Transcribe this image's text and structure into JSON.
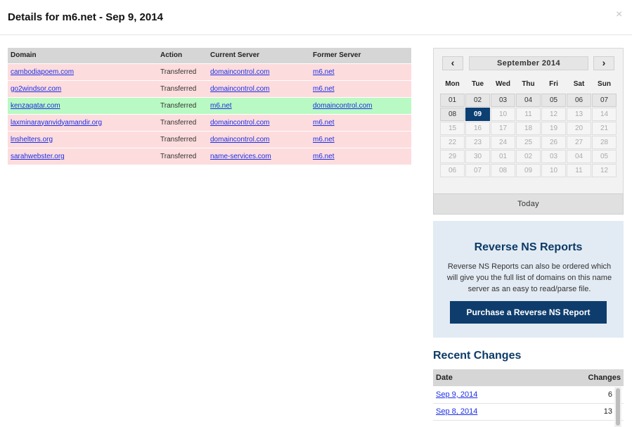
{
  "dialog": {
    "title": "Details for m6.net - Sep 9, 2014",
    "close_icon": "×"
  },
  "domains_table": {
    "headers": [
      "Domain",
      "Action",
      "Current Server",
      "Former Server"
    ],
    "rows": [
      {
        "domain": "cambodiapoem.com",
        "action": "Transferred",
        "current": "domaincontrol.com",
        "former": "m6.net",
        "status_color": "#fddcdd"
      },
      {
        "domain": "go2windsor.com",
        "action": "Transferred",
        "current": "domaincontrol.com",
        "former": "m6.net",
        "status_color": "#fddcdd"
      },
      {
        "domain": "kenzaqatar.com",
        "action": "Transferred",
        "current": "m6.net",
        "former": "domaincontrol.com",
        "status_color": "#b9f9c3"
      },
      {
        "domain": "laxminarayanvidyamandir.org",
        "action": "Transferred",
        "current": "domaincontrol.com",
        "former": "m6.net",
        "status_color": "#fddcdd"
      },
      {
        "domain": "lnshelters.org",
        "action": "Transferred",
        "current": "domaincontrol.com",
        "former": "m6.net",
        "status_color": "#fddcdd"
      },
      {
        "domain": "sarahwebster.org",
        "action": "Transferred",
        "current": "name-services.com",
        "former": "m6.net",
        "status_color": "#fddcdd"
      }
    ]
  },
  "calendar": {
    "prev_label": "‹",
    "next_label": "›",
    "month_label": "September 2014",
    "weekdays": [
      "Mon",
      "Tue",
      "Wed",
      "Thu",
      "Fri",
      "Sat",
      "Sun"
    ],
    "days": [
      {
        "label": "01",
        "state": "enabled"
      },
      {
        "label": "02",
        "state": "enabled"
      },
      {
        "label": "03",
        "state": "enabled"
      },
      {
        "label": "04",
        "state": "enabled"
      },
      {
        "label": "05",
        "state": "enabled"
      },
      {
        "label": "06",
        "state": "enabled"
      },
      {
        "label": "07",
        "state": "enabled"
      },
      {
        "label": "08",
        "state": "enabled"
      },
      {
        "label": "09",
        "state": "selected"
      },
      {
        "label": "10",
        "state": "disabled"
      },
      {
        "label": "11",
        "state": "disabled"
      },
      {
        "label": "12",
        "state": "disabled"
      },
      {
        "label": "13",
        "state": "disabled"
      },
      {
        "label": "14",
        "state": "disabled"
      },
      {
        "label": "15",
        "state": "disabled"
      },
      {
        "label": "16",
        "state": "disabled"
      },
      {
        "label": "17",
        "state": "disabled"
      },
      {
        "label": "18",
        "state": "disabled"
      },
      {
        "label": "19",
        "state": "disabled"
      },
      {
        "label": "20",
        "state": "disabled"
      },
      {
        "label": "21",
        "state": "disabled"
      },
      {
        "label": "22",
        "state": "disabled"
      },
      {
        "label": "23",
        "state": "disabled"
      },
      {
        "label": "24",
        "state": "disabled"
      },
      {
        "label": "25",
        "state": "disabled"
      },
      {
        "label": "26",
        "state": "disabled"
      },
      {
        "label": "27",
        "state": "disabled"
      },
      {
        "label": "28",
        "state": "disabled"
      },
      {
        "label": "29",
        "state": "disabled"
      },
      {
        "label": "30",
        "state": "disabled"
      },
      {
        "label": "01",
        "state": "disabled"
      },
      {
        "label": "02",
        "state": "disabled"
      },
      {
        "label": "03",
        "state": "disabled"
      },
      {
        "label": "04",
        "state": "disabled"
      },
      {
        "label": "05",
        "state": "disabled"
      },
      {
        "label": "06",
        "state": "disabled"
      },
      {
        "label": "07",
        "state": "disabled"
      },
      {
        "label": "08",
        "state": "disabled"
      },
      {
        "label": "09",
        "state": "disabled"
      },
      {
        "label": "10",
        "state": "disabled"
      },
      {
        "label": "11",
        "state": "disabled"
      },
      {
        "label": "12",
        "state": "disabled"
      }
    ],
    "today_label": "Today"
  },
  "reverse_ns": {
    "title": "Reverse NS Reports",
    "text": "Reverse NS Reports can also be ordered which will give you the full list of domains on this name server as an easy to read/parse file.",
    "button_label": "Purchase a Reverse NS Report"
  },
  "recent_changes": {
    "title": "Recent Changes",
    "headers": [
      "Date",
      "Changes"
    ],
    "rows": [
      {
        "date": "Sep 9, 2014",
        "changes": "6"
      },
      {
        "date": "Sep 8, 2014",
        "changes": "13"
      }
    ]
  },
  "colors": {
    "accent": "#0e3d6d",
    "link": "#1b2ee6",
    "removed_row": "#fddcdd",
    "added_row": "#b9f9c3"
  }
}
